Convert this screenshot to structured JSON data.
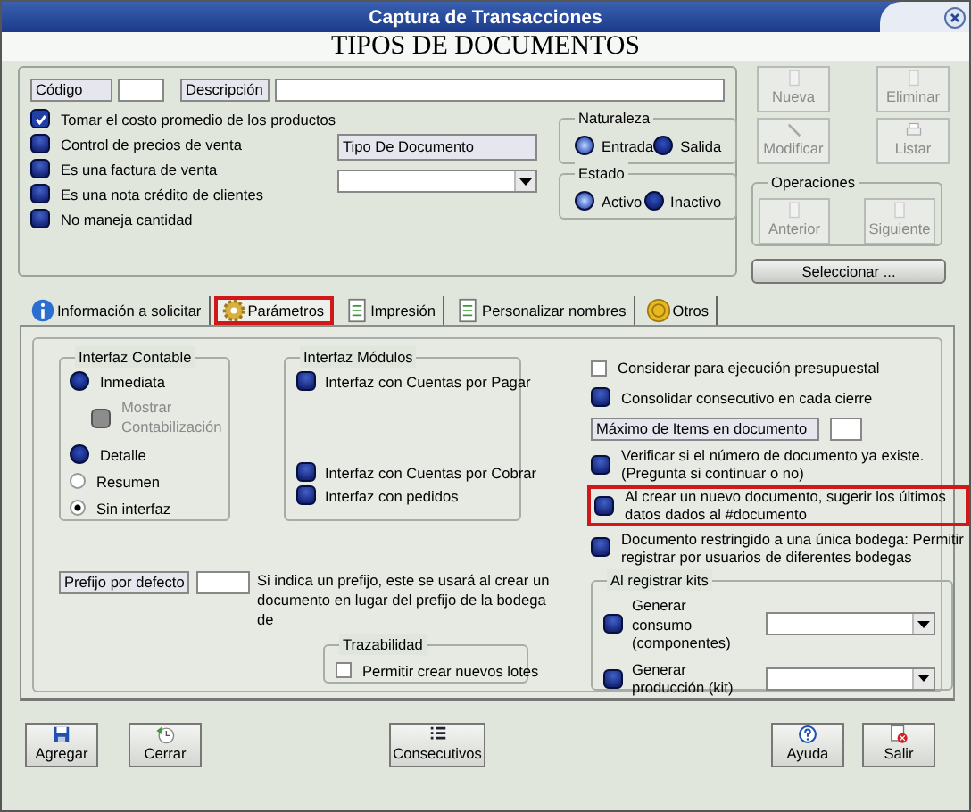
{
  "window": {
    "title": "Captura de Transacciones"
  },
  "header": "TIPOS DE DOCUMENTOS",
  "codigo": {
    "label": "Código"
  },
  "descripcion": {
    "label": "Descripción"
  },
  "options": [
    {
      "label": "Tomar el costo promedio de los productos",
      "checked": true
    },
    {
      "label": "Control de precios de venta",
      "checked": false
    },
    {
      "label": "Es una factura de venta",
      "checked": false
    },
    {
      "label": "Es una nota crédito de clientes",
      "checked": false
    },
    {
      "label": "No maneja cantidad",
      "checked": false
    }
  ],
  "tipo_documento": {
    "value": "Tipo De Documento"
  },
  "naturaleza": {
    "title": "Naturaleza",
    "options": [
      {
        "label": "Entrada",
        "selected": true
      },
      {
        "label": "Salida",
        "selected": false
      }
    ]
  },
  "estado": {
    "title": "Estado",
    "options": [
      {
        "label": "Activo",
        "selected": true
      },
      {
        "label": "Inactivo",
        "selected": false
      }
    ]
  },
  "actions": [
    {
      "label": "Nueva",
      "disabled": true
    },
    {
      "label": "Eliminar",
      "disabled": true
    },
    {
      "label": "Modificar",
      "disabled": true
    },
    {
      "label": "Listar",
      "disabled": true
    }
  ],
  "operaciones": {
    "title": "Operaciones",
    "buttons": [
      {
        "label": "Anterior",
        "disabled": true
      },
      {
        "label": "Siguiente",
        "disabled": true
      }
    ]
  },
  "select_button": "Seleccionar ...",
  "tabs": [
    {
      "label": "Información a solicitar",
      "selected": false,
      "highlighted": false
    },
    {
      "label": "Parámetros",
      "selected": true,
      "highlighted": true
    },
    {
      "label": "Impresión",
      "selected": false,
      "highlighted": false
    },
    {
      "label": "Personalizar nombres",
      "selected": false,
      "highlighted": false
    },
    {
      "label": "Otros",
      "selected": false,
      "highlighted": false
    }
  ],
  "interfaz_contable": {
    "title": "Interfaz Contable",
    "options": [
      {
        "kind": "blue-radio",
        "label": "Inmediata",
        "selected": false
      },
      {
        "kind": "sub-checkbox",
        "label": "Mostrar Contabilización",
        "disabled": true
      },
      {
        "kind": "blue-radio",
        "label": "Detalle",
        "selected": false
      },
      {
        "kind": "radio",
        "label": "Resumen",
        "selected": false
      },
      {
        "kind": "radio",
        "label": "Sin interfaz",
        "selected": true
      }
    ]
  },
  "interfaz_modulos": {
    "title": "Interfaz Módulos",
    "items": [
      {
        "label": "Interfaz con Cuentas por Pagar",
        "checked": false
      },
      {
        "label": "Interfaz con Cuentas por Cobrar",
        "checked": false
      },
      {
        "label": "Interfaz con pedidos",
        "checked": false
      }
    ]
  },
  "prefijo": {
    "label": "Prefijo por defecto",
    "note": "Si indica un prefijo, este se usará al crear un documento en lugar del prefijo de la bodega de"
  },
  "trazabilidad": {
    "title": "Trazabilidad",
    "items": [
      {
        "label": "Permitir crear nuevos lotes",
        "checked": false
      }
    ]
  },
  "settings": [
    {
      "kind": "checkbox",
      "label": "Considerar para ejecución presupuestal",
      "checked": false,
      "highlighted": false
    },
    {
      "kind": "toggle",
      "label": "Consolidar consecutivo en cada cierre",
      "checked": false,
      "highlighted": false
    },
    {
      "kind": "field",
      "label": "Máximo de Items en documento"
    },
    {
      "kind": "toggle",
      "label": "Verificar si el número de documento ya existe. (Pregunta si continuar o no)",
      "checked": false,
      "highlighted": false
    },
    {
      "kind": "toggle",
      "label": "Al crear un nuevo documento, sugerir los últimos datos dados al #documento",
      "checked": false,
      "highlighted": true
    },
    {
      "kind": "toggle",
      "label": "Documento restringido a una única bodega: Permitir registrar por usuarios de diferentes bodegas",
      "checked": false,
      "highlighted": false
    }
  ],
  "kits": {
    "title": "Al registrar kits",
    "items": [
      {
        "label": "Generar consumo (componentes)",
        "checked": false
      },
      {
        "label": "Generar producción (kit)",
        "checked": false
      }
    ]
  },
  "bottom_buttons": [
    {
      "label": "Agregar"
    },
    {
      "label": "Cerrar"
    },
    {
      "label": "Consecutivos"
    },
    {
      "label": "Ayuda"
    },
    {
      "label": "Salir"
    }
  ]
}
